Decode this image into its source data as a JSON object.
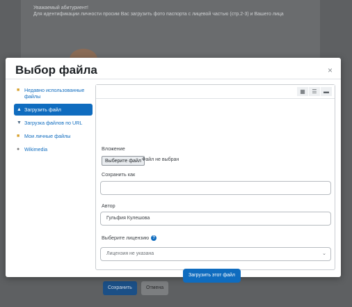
{
  "background": {
    "notice_line1": "Уважаемый абитуриент!",
    "notice_line2": "Для идентификации личности просим Вас загрузить фото паспорта с лицевой частью (стр.2-3) и Вашего лица",
    "save_label": "Сохранить",
    "cancel_label": "Отмена"
  },
  "modal": {
    "title": "Выбор файла",
    "close_glyph": "×"
  },
  "nav": {
    "items": [
      {
        "label": "Недавно использованные файлы",
        "icon": "recent-files-icon"
      },
      {
        "label": "Загрузить файл",
        "icon": "upload-icon"
      },
      {
        "label": "Загрузка файлов по URL",
        "icon": "url-download-icon"
      },
      {
        "label": "Мои личные файлы",
        "icon": "private-files-icon"
      },
      {
        "label": "Wikimedia",
        "icon": "wikimedia-icon"
      }
    ]
  },
  "form": {
    "attachment_label": "Вложение",
    "choose_file_label": "Выберите файл",
    "file_status": "Файл не выбран",
    "save_as_label": "Сохранить как",
    "save_as_value": "",
    "author_label": "Автор",
    "author_value": "Гульфия Кулешова",
    "license_label": "Выберите лицензию",
    "license_value": "Лицензия не указана",
    "upload_button_label": "Загрузить этот файл"
  },
  "colors": {
    "accent": "#0f6cbf"
  }
}
